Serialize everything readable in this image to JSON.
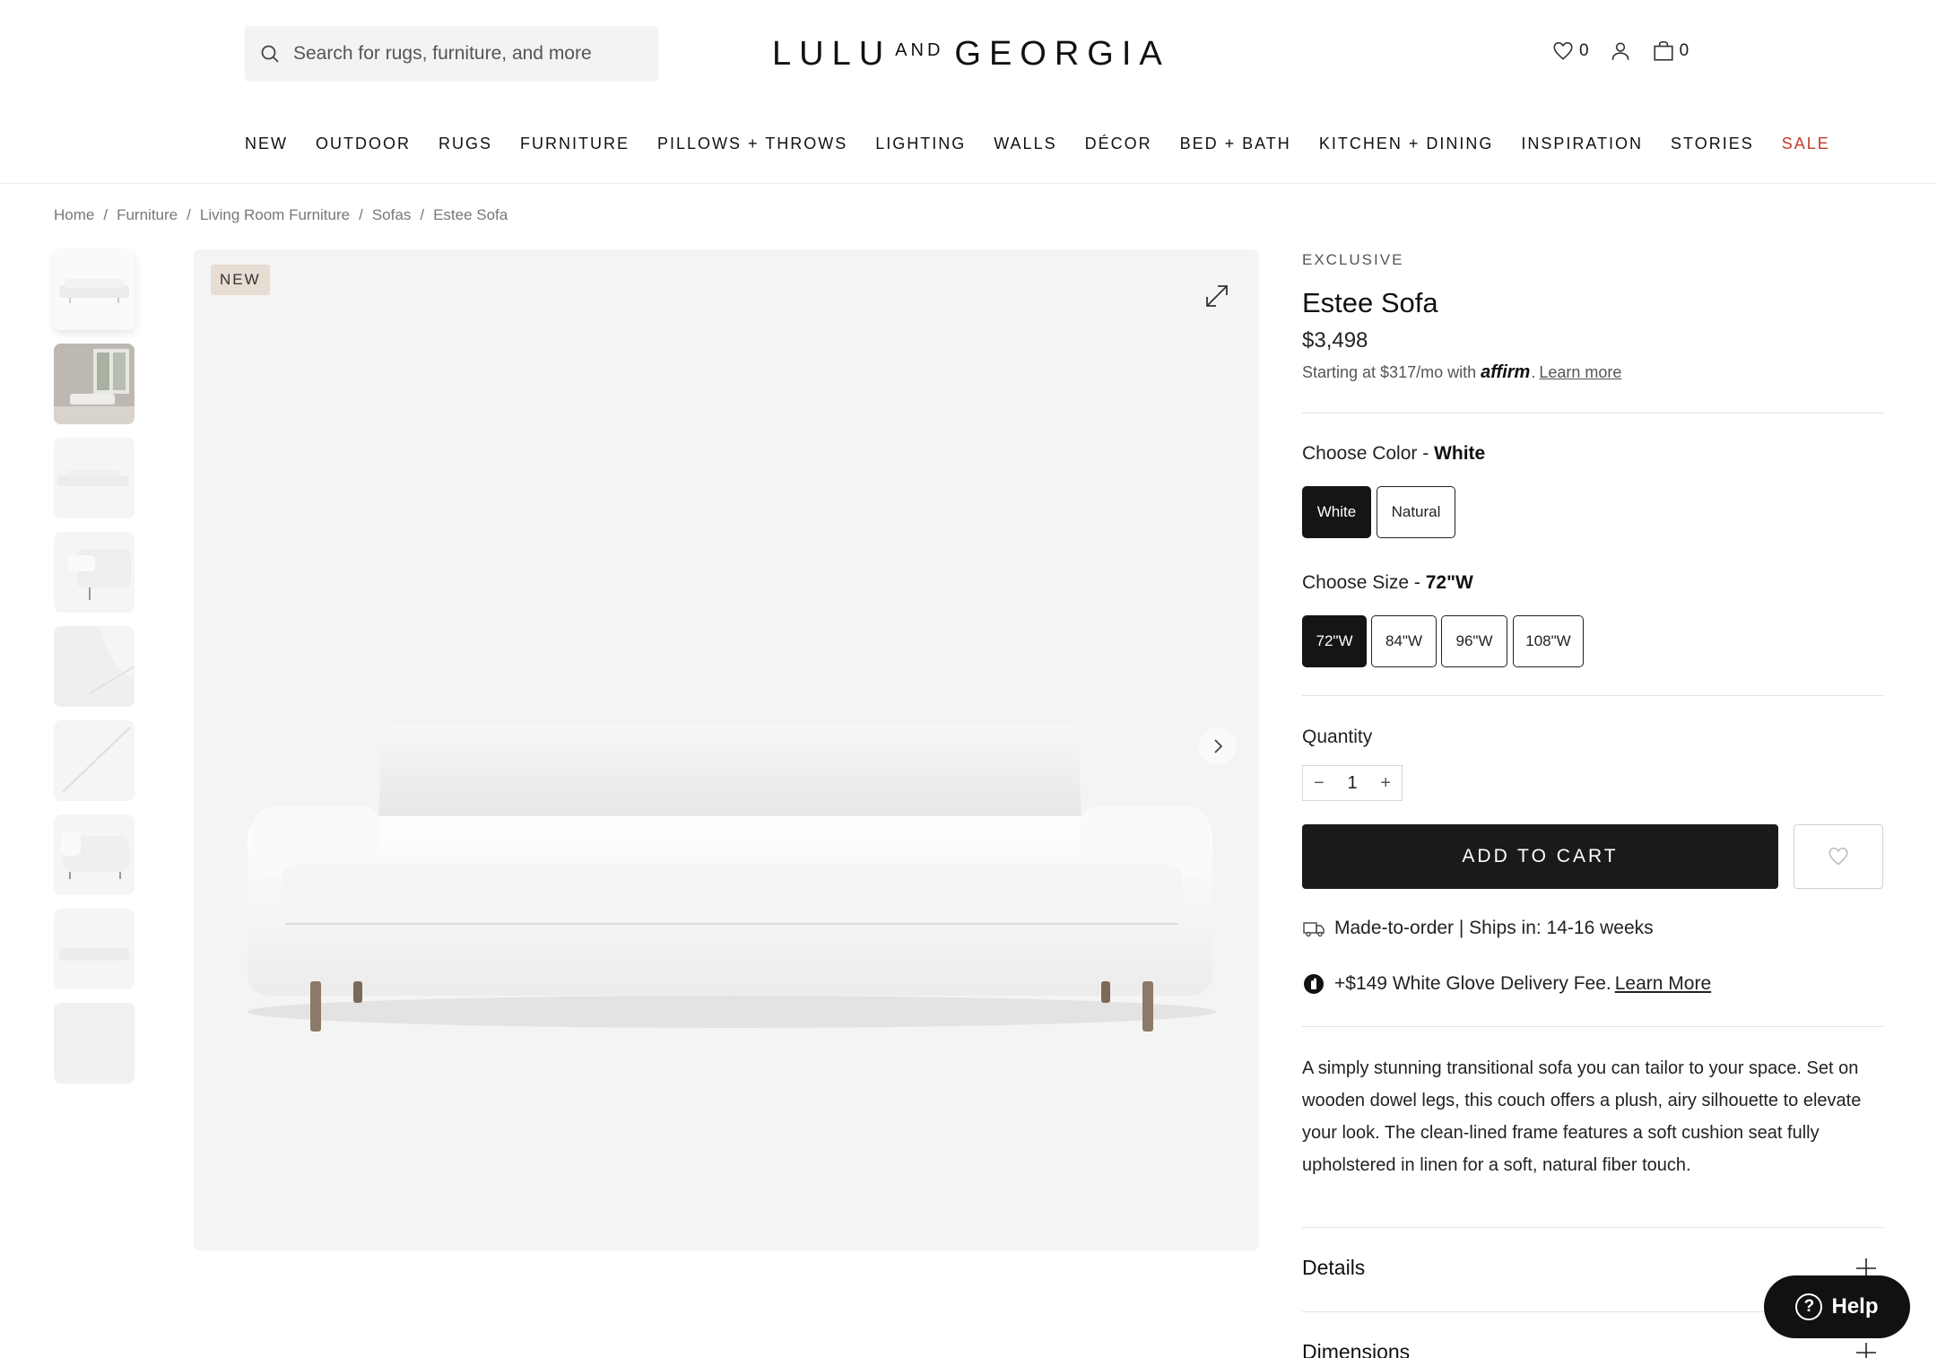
{
  "header": {
    "search_placeholder": "Search for rugs, furniture, and more",
    "logo_left": "LULU",
    "logo_mid": "AND",
    "logo_right": "GEORGIA",
    "wishlist_count": "0",
    "cart_count": "0"
  },
  "nav": [
    "NEW",
    "OUTDOOR",
    "RUGS",
    "FURNITURE",
    "PILLOWS + THROWS",
    "LIGHTING",
    "WALLS",
    "DÉCOR",
    "BED + BATH",
    "KITCHEN + DINING",
    "INSPIRATION",
    "STORIES",
    "SALE"
  ],
  "breadcrumb": [
    "Home",
    "Furniture",
    "Living Room Furniture",
    "Sofas",
    "Estee Sofa"
  ],
  "gallery": {
    "badge": "NEW",
    "thumbnail_count": 9
  },
  "product": {
    "eyebrow": "EXCLUSIVE",
    "title": "Estee Sofa",
    "price": "$3,498",
    "financing_prefix": "Starting at $317/mo with",
    "financing_brand": "affirm",
    "financing_link": "Learn more",
    "color_label": "Choose Color - ",
    "color_selected": "White",
    "colors": [
      "White",
      "Natural"
    ],
    "size_label": "Choose Size - ",
    "size_selected": "72\"W",
    "sizes": [
      "72\"W",
      "84\"W",
      "96\"W",
      "108\"W"
    ],
    "quantity_label": "Quantity",
    "quantity": "1",
    "add_to_cart": "ADD TO CART",
    "shipping_text": "Made-to-order | Ships in:  14-16 weeks",
    "delivery_text": "+$149 White Glove Delivery Fee.",
    "delivery_link": "Learn More",
    "description": "A simply stunning transitional sofa you can tailor to your space. Set on wooden dowel legs, this couch offers a plush, airy silhouette to elevate your look. The clean-lined frame features a soft cushion seat fully upholstered in linen for a soft, natural fiber touch.",
    "accordion": [
      "Details",
      "Dimensions"
    ]
  },
  "help_label": "Help",
  "colors": {
    "sale": "#c03b2b",
    "selected_option": "#151515",
    "badge_bg": "#e7ddd3"
  }
}
